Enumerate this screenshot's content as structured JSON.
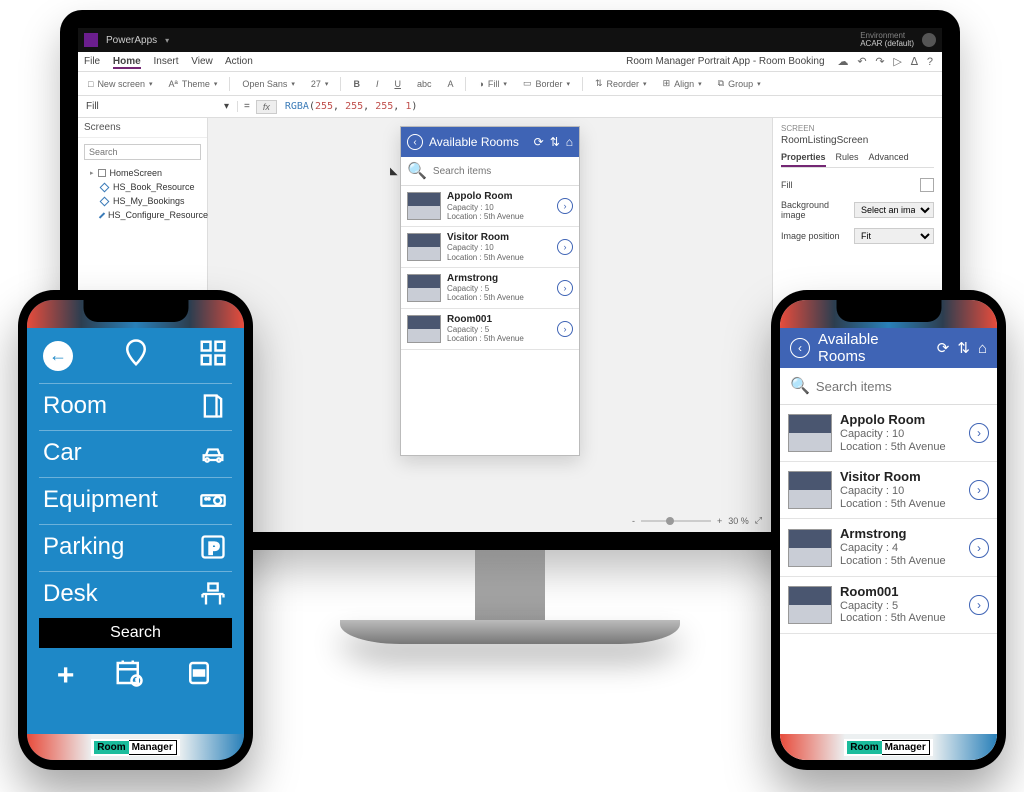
{
  "topbar": {
    "app": "PowerApps",
    "env_label": "Environment",
    "env_value": "ACAR (default)"
  },
  "menubar": {
    "tabs": [
      "File",
      "Home",
      "Insert",
      "View",
      "Action"
    ],
    "doc_title": "Room Manager Portrait App - Room Booking"
  },
  "ribbon": {
    "new_screen": "New screen",
    "theme": "Theme",
    "font": "Open Sans",
    "size": "27",
    "fill": "Fill",
    "border": "Border",
    "reorder": "Reorder",
    "align": "Align",
    "group": "Group"
  },
  "formula": {
    "prop": "Fill",
    "fn": "RGBA",
    "args": "255, 255, 255, 1"
  },
  "leftpane": {
    "hdr": "Screens",
    "search_ph": "Search",
    "root": "HomeScreen",
    "children": [
      "HS_Book_Resource",
      "HS_My_Bookings",
      "HS_Configure_Resource"
    ]
  },
  "rightpane": {
    "lbl": "SCREEN",
    "name": "RoomListingScreen",
    "tabs": [
      "Properties",
      "Rules",
      "Advanced"
    ],
    "fill": "Fill",
    "bg": "Background image",
    "bg_val": "Select an image...",
    "pos": "Image position",
    "pos_val": "Fit"
  },
  "zoom": {
    "minus": "-",
    "plus": "+",
    "value": "30 %"
  },
  "rooms": {
    "title": "Available Rooms",
    "search_ph": "Search items",
    "cap_lbl": "Capacity : ",
    "loc_lbl": "Location : ",
    "items": [
      {
        "name": "Appolo Room",
        "cap": "10",
        "loc": "5th Avenue"
      },
      {
        "name": "Visitor Room",
        "cap": "10",
        "loc": "5th Avenue"
      },
      {
        "name": "Armstrong",
        "cap": "5",
        "loc": "5th Avenue"
      },
      {
        "name": "Room001",
        "cap": "5",
        "loc": "5th Avenue"
      }
    ],
    "items2": [
      {
        "name": "Appolo Room",
        "cap": "10",
        "loc": "5th Avenue"
      },
      {
        "name": "Visitor Room",
        "cap": "10",
        "loc": "5th Avenue"
      },
      {
        "name": "Armstrong",
        "cap": "4",
        "loc": "5th Avenue"
      },
      {
        "name": "Room001",
        "cap": "5",
        "loc": "5th Avenue"
      }
    ]
  },
  "phone1": {
    "cats": [
      "Room",
      "Car",
      "Equipment",
      "Parking",
      "Desk"
    ],
    "search": "Search"
  },
  "brand": {
    "room": "Room",
    "mgr": "Manager"
  }
}
